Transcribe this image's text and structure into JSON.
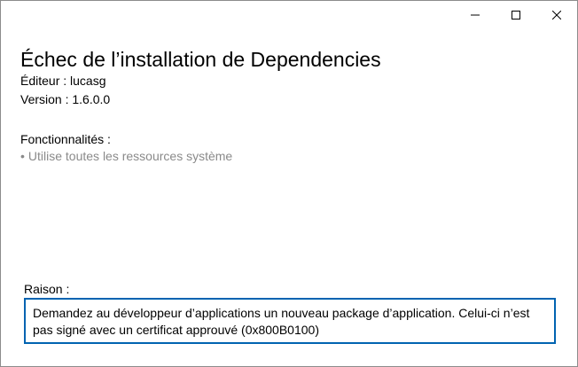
{
  "window": {
    "controls": [
      {
        "name": "minimize-button",
        "icon": "minimize-icon"
      },
      {
        "name": "maximize-button",
        "icon": "maximize-icon"
      },
      {
        "name": "close-button",
        "icon": "close-icon"
      }
    ]
  },
  "install": {
    "title": "Échec de l’installation de Dependencies",
    "publisher": "Éditeur : lucasg",
    "version": "Version : 1.6.0.0"
  },
  "capabilities": {
    "heading": "Fonctionnalités :",
    "items": [
      {
        "label": "Utilise toutes les ressources système"
      }
    ]
  },
  "reason": {
    "label": "Raison :",
    "message": "Demandez au développeur d’applications un nouveau package d’application. Celui-ci n’est pas signé avec un certificat approuvé (0x800B0100)"
  },
  "colors": {
    "accent": "#0063b1",
    "muted_text": "#8a8a8a"
  }
}
